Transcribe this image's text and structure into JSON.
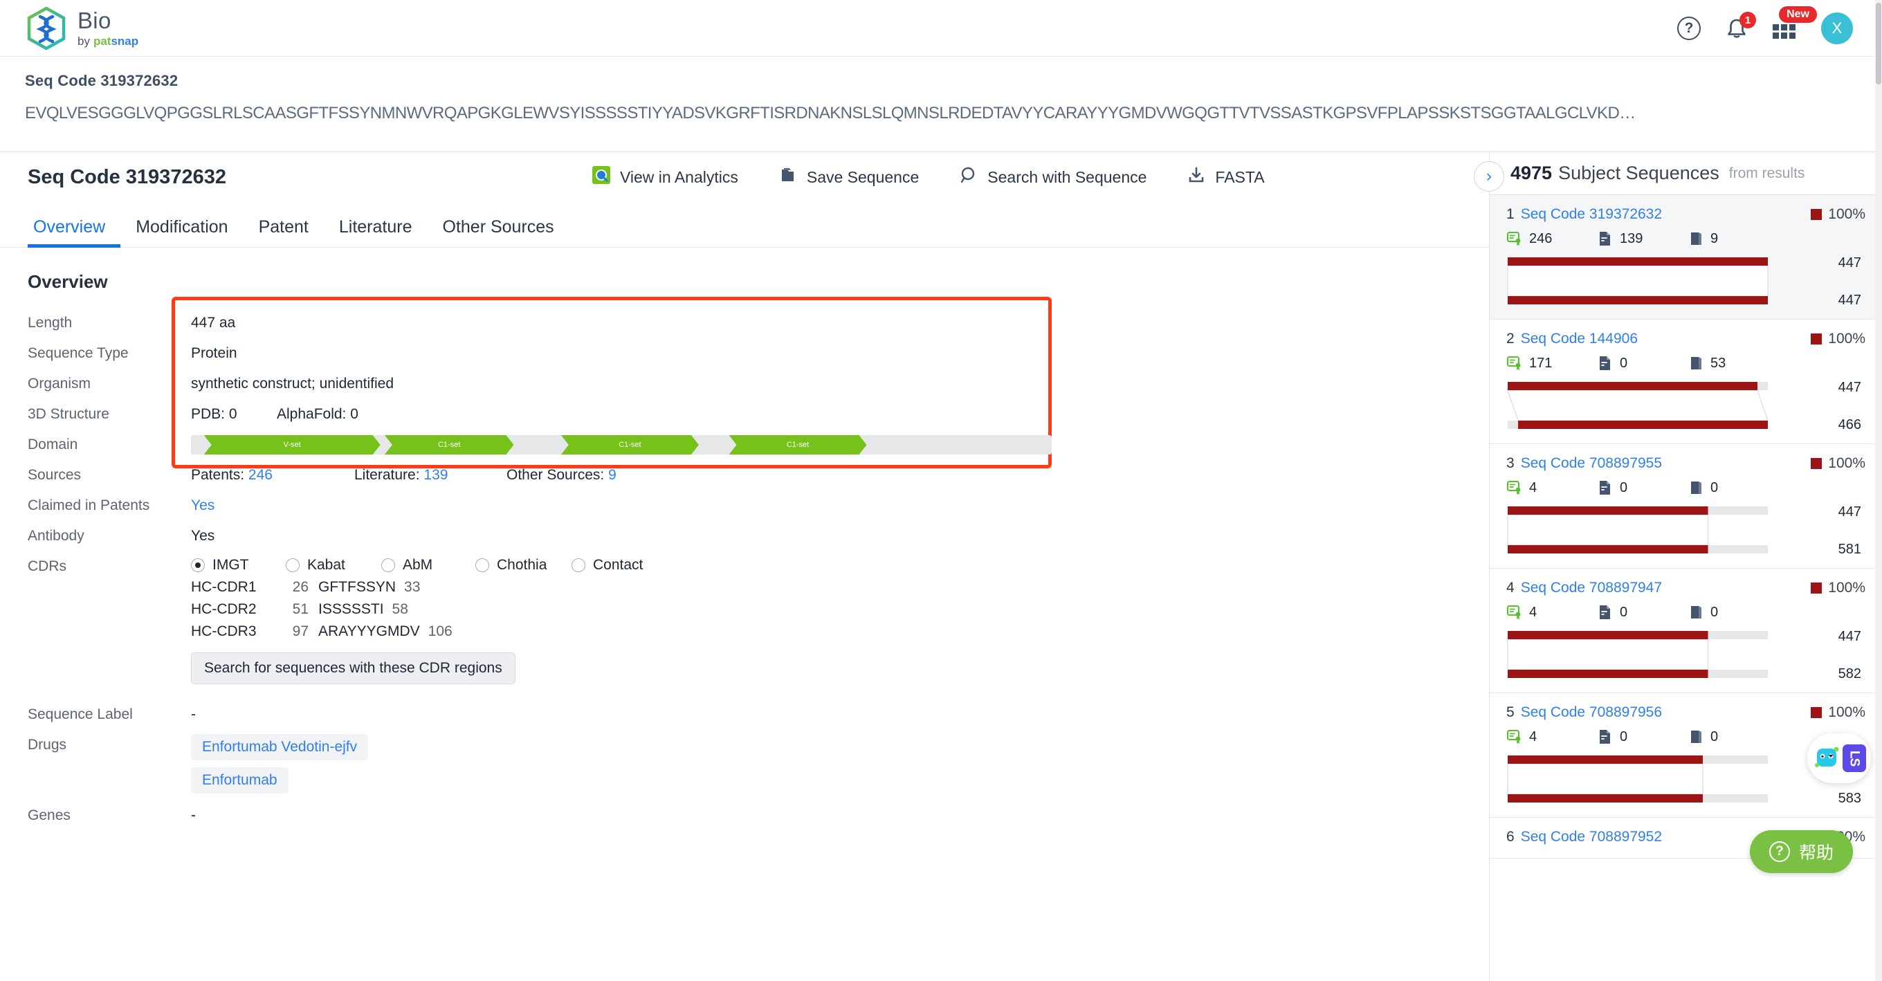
{
  "header": {
    "logo_title": "Bio",
    "logo_by": "by",
    "logo_pat": "pat",
    "logo_snap": "snap",
    "help_icon": "question-circle-icon",
    "bell_icon": "bell-icon",
    "bell_badge": "1",
    "grid_icon": "apps-grid-icon",
    "grid_badge": "New",
    "avatar_text": "X"
  },
  "seq_strip": {
    "title": "Seq Code 319372632",
    "sequence": "EVQLVESGGGLVQPGGSLRLSCAASGFTFSSYNMNWVRQAPGKGLEWVSYISSSSSTIYYADSVKGRFTISRDNAKNSLSLQMNSLRDEDTAVYYCARAYYYGMDVWGQGTTVTVSSASTKGPSVFPLAPSSKSTSGGTAALGCLVKD…"
  },
  "main": {
    "title": "Seq Code 319372632",
    "actions": [
      {
        "label": "View in Analytics",
        "icon": "analytics-icon"
      },
      {
        "label": "Save Sequence",
        "icon": "folder-save-icon"
      },
      {
        "label": "Search with Sequence",
        "icon": "magnifier-icon"
      },
      {
        "label": "FASTA",
        "icon": "download-icon"
      }
    ],
    "tabs": [
      {
        "label": "Overview",
        "active": true
      },
      {
        "label": "Modification",
        "active": false
      },
      {
        "label": "Patent",
        "active": false
      },
      {
        "label": "Literature",
        "active": false
      },
      {
        "label": "Other Sources",
        "active": false
      }
    ],
    "section_title": "Overview",
    "fields": {
      "length_label": "Length",
      "length_value": "447 aa",
      "seqtype_label": "Sequence Type",
      "seqtype_value": "Protein",
      "organism_label": "Organism",
      "organism_value": "synthetic construct; unidentified",
      "structure_label": "3D Structure",
      "pdb_label": "PDB: 0",
      "alphafold_label": "AlphaFold: 0",
      "domain_label": "Domain",
      "sources_label": "Sources",
      "patents_label": "Patents:",
      "patents_value": "246",
      "literature_label": "Literature:",
      "literature_value": "139",
      "othersources_label": "Other Sources:",
      "othersources_value": "9",
      "claimed_label": "Claimed in Patents",
      "claimed_value": "Yes",
      "antibody_label": "Antibody",
      "antibody_value": "Yes",
      "cdrs_label": "CDRs",
      "seqlabel_label": "Sequence Label",
      "seqlabel_value": "-",
      "drugs_label": "Drugs",
      "genes_label": "Genes",
      "genes_value": "-"
    },
    "domains": [
      {
        "label": "V-set",
        "start": 1.5,
        "width": 20.5
      },
      {
        "label": "C1-set",
        "start": 22.5,
        "width": 15.0
      },
      {
        "label": "C1-set",
        "start": 43.0,
        "width": 16.0
      },
      {
        "label": "C1-set",
        "start": 62.5,
        "width": 16.0
      }
    ],
    "cdr_schemes": [
      {
        "label": "IMGT",
        "selected": true
      },
      {
        "label": "Kabat",
        "selected": false
      },
      {
        "label": "AbM",
        "selected": false
      },
      {
        "label": "Chothia",
        "selected": false
      },
      {
        "label": "Contact",
        "selected": false
      }
    ],
    "cdrs": [
      {
        "name": "HC-CDR1",
        "start": "26",
        "seq": "GFTFSSYN",
        "end": "33"
      },
      {
        "name": "HC-CDR2",
        "start": "51",
        "seq": "ISSSSSTI",
        "end": "58"
      },
      {
        "name": "HC-CDR3",
        "start": "97",
        "seq": "ARAYYYGMDV",
        "end": "106"
      }
    ],
    "cdr_button": "Search for sequences with these CDR regions",
    "drugs": [
      "Enfortumab Vedotin-ejfv",
      "Enfortumab"
    ]
  },
  "right_panel": {
    "collapse_icon": "chevron-right-icon",
    "count": "4975",
    "title": "Subject Sequences",
    "from": "from results",
    "items": [
      {
        "index": "1",
        "code": "Seq Code 319372632",
        "pct": "100%",
        "selected": true,
        "patents": "246",
        "literature": "139",
        "other": "9",
        "query_len": "447",
        "subject_len": "447",
        "q_start": 0,
        "q_end": 100,
        "s_start": 0,
        "s_end": 100
      },
      {
        "index": "2",
        "code": "Seq Code 144906",
        "pct": "100%",
        "selected": false,
        "patents": "171",
        "literature": "0",
        "other": "53",
        "query_len": "447",
        "subject_len": "466",
        "q_start": 0,
        "q_end": 96,
        "s_start": 4,
        "s_end": 100
      },
      {
        "index": "3",
        "code": "Seq Code 708897955",
        "pct": "100%",
        "selected": false,
        "patents": "4",
        "literature": "0",
        "other": "0",
        "query_len": "447",
        "subject_len": "581",
        "q_start": 0,
        "q_end": 77,
        "s_start": 0,
        "s_end": 77
      },
      {
        "index": "4",
        "code": "Seq Code 708897947",
        "pct": "100%",
        "selected": false,
        "patents": "4",
        "literature": "0",
        "other": "0",
        "query_len": "447",
        "subject_len": "582",
        "q_start": 0,
        "q_end": 77,
        "s_start": 0,
        "s_end": 77
      },
      {
        "index": "5",
        "code": "Seq Code 708897956",
        "pct": "100%",
        "selected": false,
        "patents": "4",
        "literature": "0",
        "other": "0",
        "query_len": "447",
        "subject_len": "583",
        "q_start": 0,
        "q_end": 75,
        "s_start": 0,
        "s_end": 75
      },
      {
        "index": "6",
        "code": "Seq Code 708897952",
        "pct": "100%",
        "selected": false,
        "patents": "",
        "literature": "",
        "other": "",
        "query_len": "",
        "subject_len": "",
        "q_start": 0,
        "q_end": 0,
        "s_start": 0,
        "s_end": 0
      }
    ]
  },
  "floating": {
    "assistant_label": "LS",
    "help_label": "帮助",
    "help_icon": "question-circle-icon"
  },
  "colors": {
    "accent_blue": "#2f80ed",
    "domain_green": "#76c21b",
    "match_red": "#9d1414",
    "highlight_red": "#ff3b14",
    "brand_cyan": "#3bbfd6"
  }
}
